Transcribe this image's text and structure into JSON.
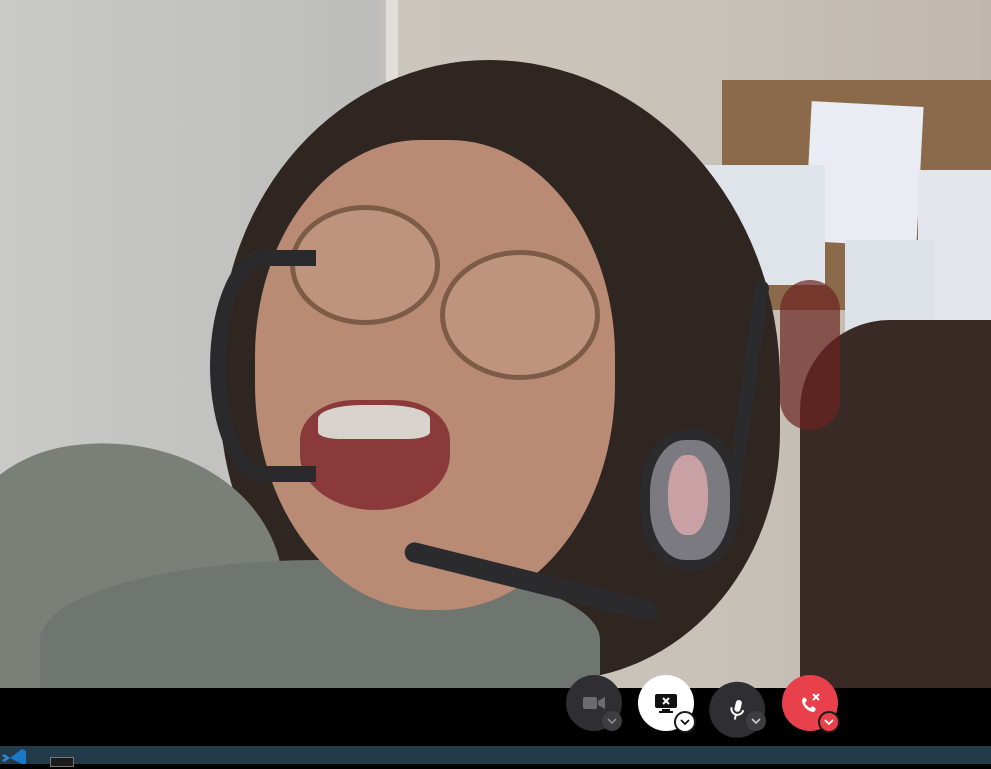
{
  "call": {
    "controls": [
      {
        "name": "camera",
        "icon": "video-camera-icon",
        "state": "off"
      },
      {
        "name": "share-screen",
        "icon": "screen-share-off-icon",
        "state": "active"
      },
      {
        "name": "microphone",
        "icon": "microphone-icon",
        "state": "on"
      },
      {
        "name": "hang-up",
        "icon": "phone-hangup-icon",
        "state": "danger"
      }
    ],
    "colors": {
      "control_dark": "#2f2f33",
      "control_light": "#ffffff",
      "hangup_red": "#e8414b",
      "bar_background": "#000000",
      "taskbar": "#223a4a"
    }
  },
  "taskbar": {
    "icons": [
      "vscode-icon",
      "terminal-icon"
    ]
  }
}
